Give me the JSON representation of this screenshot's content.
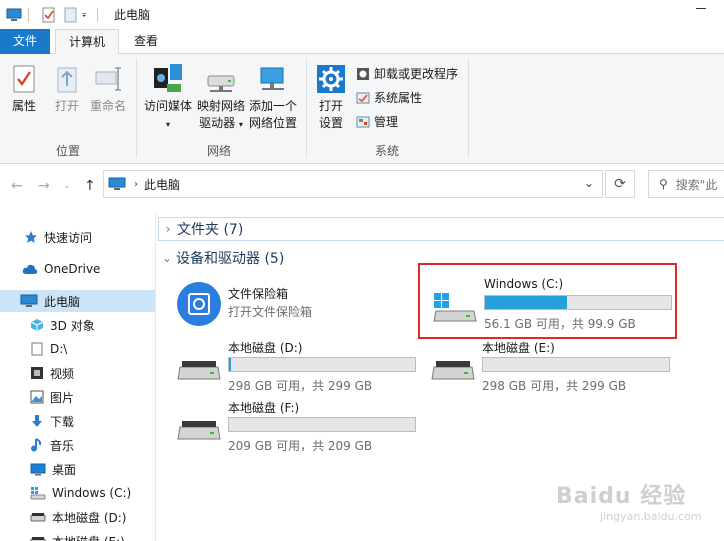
{
  "window": {
    "title": "此电脑"
  },
  "tabs": {
    "file": "文件",
    "computer": "计算机",
    "view": "查看"
  },
  "ribbon": {
    "properties": "属性",
    "open": "打开",
    "rename": "重命名",
    "access_media": "访问媒体",
    "map_drive_line1": "映射网络",
    "map_drive_line2": "驱动器",
    "add_location_line1": "添加一个",
    "add_location_line2": "网络位置",
    "open_settings_line1": "打开",
    "open_settings_line2": "设置",
    "uninstall": "卸载或更改程序",
    "system_props": "系统属性",
    "manage": "管理",
    "group_location": "位置",
    "group_network": "网络",
    "group_system": "系统"
  },
  "address": {
    "path": "此电脑",
    "search_placeholder": "搜索\"此"
  },
  "sidebar": {
    "items": [
      {
        "label": "快速访问"
      },
      {
        "label": "OneDrive"
      },
      {
        "label": "此电脑"
      },
      {
        "label": "3D 对象"
      },
      {
        "label": "D:\\"
      },
      {
        "label": "视频"
      },
      {
        "label": "图片"
      },
      {
        "label": "下载"
      },
      {
        "label": "音乐"
      },
      {
        "label": "桌面"
      },
      {
        "label": "Windows (C:)"
      },
      {
        "label": "本地磁盘 (D:)"
      },
      {
        "label": "本地磁盘 (E:)"
      }
    ]
  },
  "main": {
    "folders_header": "文件夹 (7)",
    "devices_header": "设备和驱动器 (5)",
    "vault": {
      "name": "文件保险箱",
      "desc": "打开文件保险箱"
    },
    "drives": [
      {
        "name": "Windows (C:)",
        "size": "56.1 GB 可用，共 99.9 GB",
        "used_fraction": 0.44
      },
      {
        "name": "本地磁盘 (D:)",
        "size": "298 GB 可用，共 299 GB",
        "used_fraction": 0.01
      },
      {
        "name": "本地磁盘 (E:)",
        "size": "298 GB 可用，共 299 GB",
        "used_fraction": 0.0
      },
      {
        "name": "本地磁盘 (F:)",
        "size": "209 GB 可用，共 209 GB",
        "used_fraction": 0.0
      }
    ]
  },
  "watermark": {
    "brand": "Baidu 经验",
    "url": "jingyan.baidu.com"
  },
  "colors": {
    "accent": "#1979ca",
    "bar_fill": "#26a0da",
    "highlight": "#e3262c"
  }
}
